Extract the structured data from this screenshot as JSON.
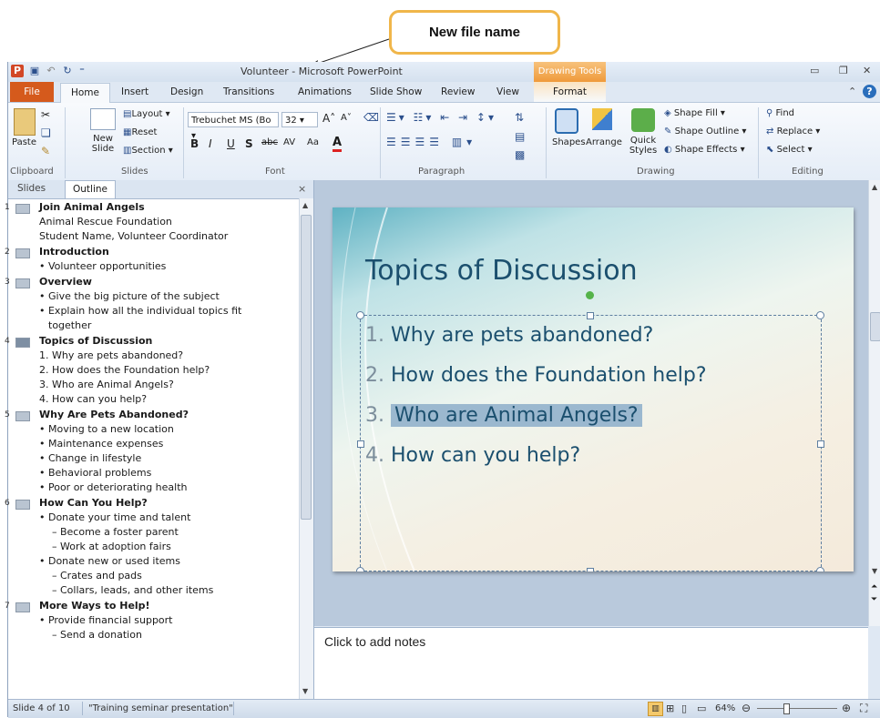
{
  "callout": {
    "label": "New file name"
  },
  "window": {
    "title": "Volunteer - Microsoft PowerPoint",
    "contextual_group": "Drawing Tools"
  },
  "tabs": [
    "File",
    "Home",
    "Insert",
    "Design",
    "Transitions",
    "Animations",
    "Slide Show",
    "Review",
    "View",
    "Format"
  ],
  "ribbon": {
    "clipboard": {
      "paste": "Paste",
      "label": "Clipboard"
    },
    "slides": {
      "new_slide": "New Slide",
      "layout": "Layout",
      "reset": "Reset",
      "section": "Section",
      "label": "Slides"
    },
    "font": {
      "family": "Trebuchet MS (Bo",
      "size": "32",
      "label": "Font",
      "bold": "B",
      "italic": "I",
      "underline": "U",
      "shadow": "S",
      "strike": "abc",
      "spacing": "AV",
      "case": "Aa",
      "color": "A"
    },
    "paragraph": {
      "label": "Paragraph"
    },
    "drawing": {
      "shapes": "Shapes",
      "arrange": "Arrange",
      "quick_styles": "Quick Styles",
      "shape_fill": "Shape Fill",
      "shape_outline": "Shape Outline",
      "shape_effects": "Shape Effects",
      "label": "Drawing"
    },
    "editing": {
      "find": "Find",
      "replace": "Replace",
      "select": "Select",
      "label": "Editing"
    }
  },
  "left_pane": {
    "tabs": [
      "Slides",
      "Outline"
    ],
    "slides": [
      {
        "num": "1",
        "title": "Join Animal Angels",
        "lines": [
          {
            "t": "Animal Rescue Foundation",
            "k": "text"
          },
          {
            "t": "Student Name, Volunteer Coordinator",
            "k": "text"
          }
        ]
      },
      {
        "num": "2",
        "title": "Introduction",
        "lines": [
          {
            "t": "• Volunteer opportunities",
            "k": "b1"
          }
        ]
      },
      {
        "num": "3",
        "title": "Overview",
        "lines": [
          {
            "t": "• Give the big picture of the subject",
            "k": "b1"
          },
          {
            "t": "• Explain how all the individual topics fit",
            "k": "b1"
          },
          {
            "t": "together",
            "k": "b1c"
          }
        ]
      },
      {
        "num": "4",
        "title": "Topics of Discussion",
        "lines": [
          {
            "t": "1. Why are pets abandoned?",
            "k": "b1"
          },
          {
            "t": "2. How does the Foundation help?",
            "k": "b1"
          },
          {
            "t": "3. Who are Animal Angels?",
            "k": "b1"
          },
          {
            "t": "4. How can you help?",
            "k": "b1"
          }
        ]
      },
      {
        "num": "5",
        "title": "Why Are Pets Abandoned?",
        "lines": [
          {
            "t": "• Moving to a new location",
            "k": "b1"
          },
          {
            "t": "• Maintenance expenses",
            "k": "b1"
          },
          {
            "t": "• Change in lifestyle",
            "k": "b1"
          },
          {
            "t": "• Behavioral problems",
            "k": "b1"
          },
          {
            "t": "• Poor or deteriorating health",
            "k": "b1"
          }
        ]
      },
      {
        "num": "6",
        "title": "How Can You Help?",
        "lines": [
          {
            "t": "• Donate your time and talent",
            "k": "b1"
          },
          {
            "t": "– Become a foster parent",
            "k": "b2"
          },
          {
            "t": "– Work at adoption fairs",
            "k": "b2"
          },
          {
            "t": "• Donate new or used items",
            "k": "b1"
          },
          {
            "t": "– Crates and pads",
            "k": "b2"
          },
          {
            "t": "– Collars, leads, and other items",
            "k": "b2"
          }
        ]
      },
      {
        "num": "7",
        "title": "More Ways to Help!",
        "lines": [
          {
            "t": "• Provide financial support",
            "k": "b1"
          },
          {
            "t": "– Send a donation",
            "k": "b2"
          }
        ]
      }
    ]
  },
  "slide": {
    "title": "Topics of Discussion",
    "items": [
      {
        "num": "1.",
        "text": "Why are pets abandoned?"
      },
      {
        "num": "2.",
        "text": "How does the Foundation help?"
      },
      {
        "num": "3.",
        "text": "Who are Animal Angels?"
      },
      {
        "num": "4.",
        "text": "How can you help?"
      }
    ]
  },
  "notes": {
    "placeholder": "Click to add notes"
  },
  "status": {
    "slide": "Slide 4 of 10",
    "theme": "\"Training seminar presentation\"",
    "zoom": "64%"
  }
}
